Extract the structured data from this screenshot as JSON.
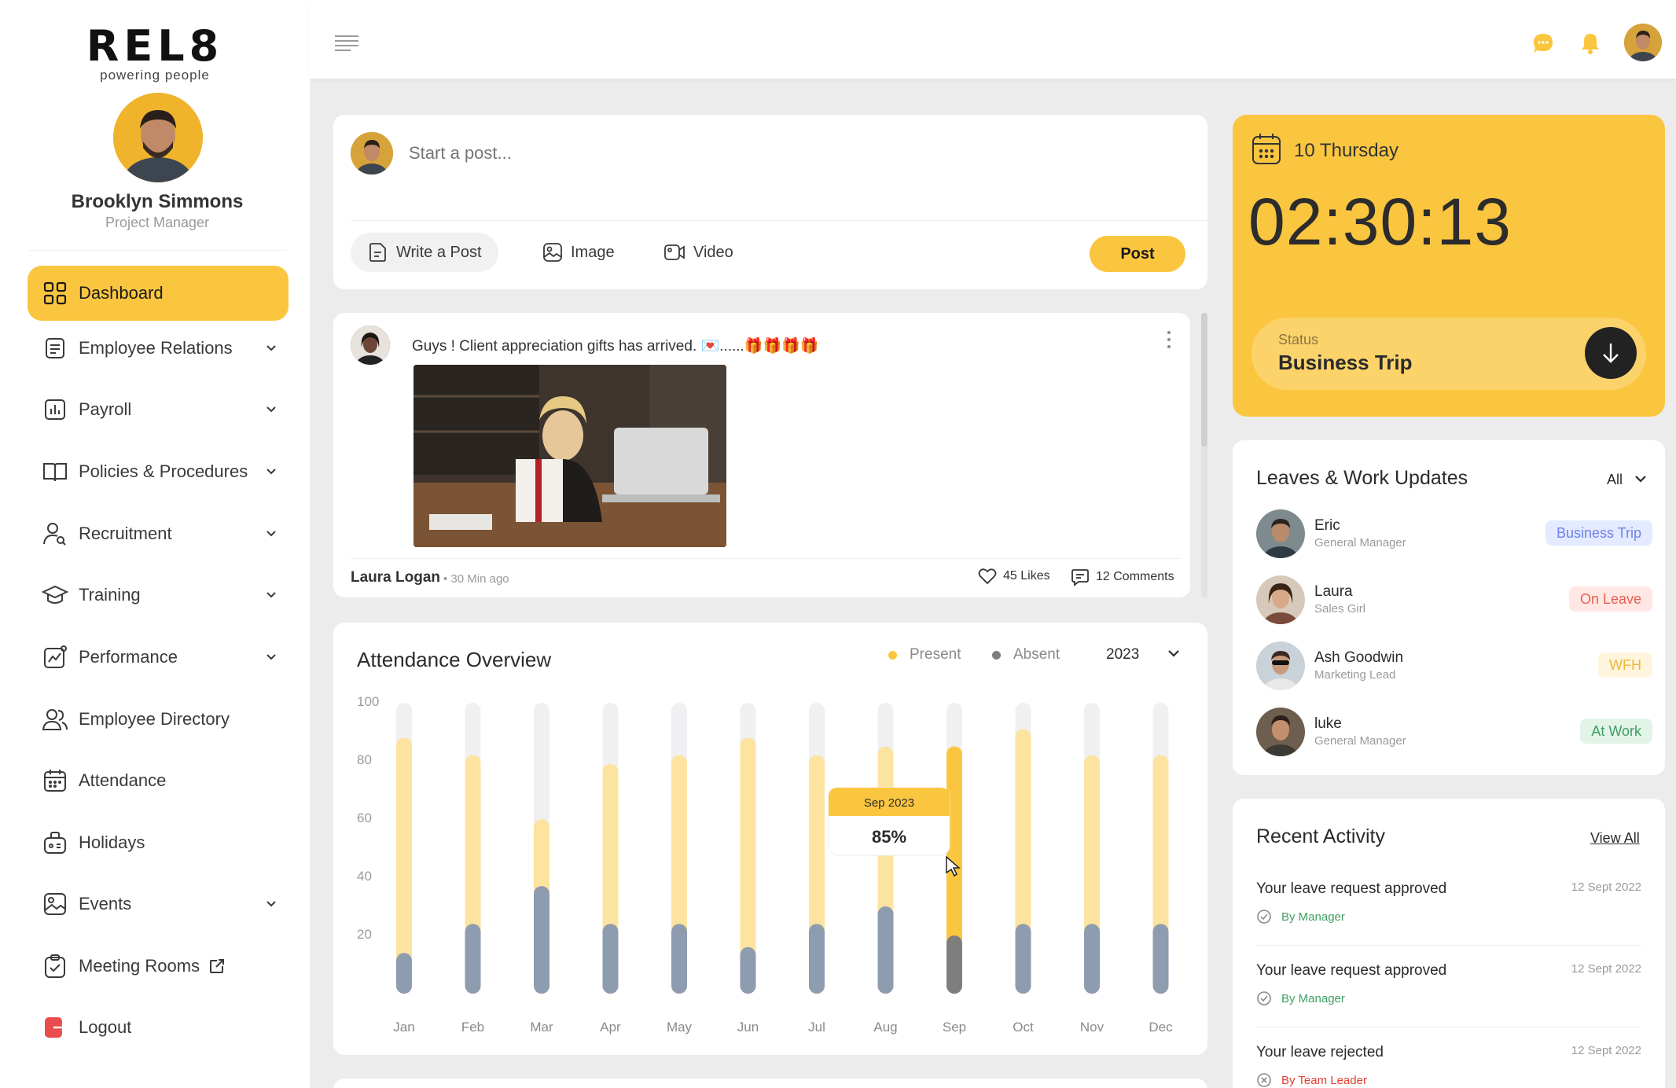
{
  "brand": {
    "name": "REL8",
    "tagline": "powering people"
  },
  "profile": {
    "name": "Brooklyn Simmons",
    "role": "Project Manager"
  },
  "nav": [
    {
      "label": "Dashboard",
      "icon": "dashboard-grid-icon",
      "active": true,
      "has_chevron": false
    },
    {
      "label": "Employee Relations",
      "icon": "document-icon",
      "has_chevron": true
    },
    {
      "label": "Payroll",
      "icon": "bar-chart-icon",
      "has_chevron": true
    },
    {
      "label": "Policies & Procedures",
      "icon": "book-icon",
      "has_chevron": true
    },
    {
      "label": "Recruitment",
      "icon": "user-search-icon",
      "has_chevron": true
    },
    {
      "label": "Training",
      "icon": "graduation-cap-icon",
      "has_chevron": true
    },
    {
      "label": "Performance",
      "icon": "trend-chart-icon",
      "has_chevron": true
    },
    {
      "label": "Employee Directory",
      "icon": "users-icon",
      "has_chevron": false
    },
    {
      "label": "Attendance",
      "icon": "calendar-icon",
      "has_chevron": false
    },
    {
      "label": "Holidays",
      "icon": "luggage-icon",
      "has_chevron": false
    },
    {
      "label": "Events",
      "icon": "image-icon",
      "has_chevron": true
    },
    {
      "label": "Meeting Rooms",
      "icon": "clipboard-check-icon",
      "has_chevron": false,
      "external": true
    },
    {
      "label": "Logout",
      "icon": "logout-icon",
      "has_chevron": false
    }
  ],
  "topbar": {
    "icons": [
      "menu-icon",
      "chat-icon",
      "bell-icon",
      "avatar"
    ]
  },
  "composer": {
    "placeholder": "Start a post...",
    "write_label": "Write a Post",
    "image_label": "Image",
    "video_label": "Video",
    "post_label": "Post"
  },
  "feed_post": {
    "text": "Guys ! Client appreciation gifts has arrived. 💌......🎁🎁🎁🎁",
    "author": "Laura Logan",
    "time": "30 Min ago",
    "likes": "45 Likes",
    "comments": "12 Comments"
  },
  "attendance": {
    "title": "Attendance Overview",
    "legend_present": "Present",
    "legend_absent": "Absent",
    "year": "2023",
    "tooltip_month": "Sep 2023",
    "tooltip_value": "85%"
  },
  "chart_data": {
    "type": "bar",
    "title": "Attendance Overview",
    "categories": [
      "Jan",
      "Feb",
      "Mar",
      "Apr",
      "May",
      "Jun",
      "Jul",
      "Aug",
      "Sep",
      "Oct",
      "Nov",
      "Dec"
    ],
    "series": [
      {
        "name": "Present",
        "values": [
          88,
          82,
          60,
          79,
          82,
          88,
          82,
          85,
          85,
          91,
          82,
          82
        ]
      },
      {
        "name": "Absent",
        "values": [
          14,
          24,
          37,
          24,
          24,
          16,
          24,
          30,
          20,
          24,
          24,
          24
        ]
      }
    ],
    "highlight": "Sep",
    "ylim": [
      0,
      100
    ],
    "yticks": [
      20,
      40,
      60,
      80,
      100
    ],
    "colors": {
      "present": "#fde3a0",
      "present_highlight": "#fbc63f",
      "absent": "#8e9cb0",
      "absent_highlight": "#7e7e7e",
      "track": "#f0f0f3"
    }
  },
  "clock": {
    "day": "10 Thursday",
    "time": "02:30:13",
    "status_label": "Status",
    "status_value": "Business Trip"
  },
  "leaves": {
    "title": "Leaves & Work Updates",
    "filter": "All",
    "rows": [
      {
        "name": "Eric",
        "role": "General Manager",
        "badge": "Business Trip",
        "badge_bg": "#e4eaff",
        "badge_color": "#6f82e8"
      },
      {
        "name": "Laura",
        "role": "Sales Girl",
        "badge": "On Leave",
        "badge_bg": "#ffe7e4",
        "badge_color": "#e8604f"
      },
      {
        "name": "Ash Goodwin",
        "role": "Marketing Lead",
        "badge": "WFH",
        "badge_bg": "#fff5dc",
        "badge_color": "#f0b63a"
      },
      {
        "name": "luke",
        "role": "General Manager",
        "badge": "At Work",
        "badge_bg": "#e2f3e8",
        "badge_color": "#3f9e62"
      }
    ]
  },
  "activity": {
    "title": "Recent Activity",
    "view_all": "View All",
    "items": [
      {
        "text": "Your leave request approved",
        "date": "12 Sept 2022",
        "by": "By Manager",
        "by_color": "#3f9e62"
      },
      {
        "text": "Your leave request approved",
        "date": "12 Sept 2022",
        "by": "By Manager",
        "by_color": "#3f9e62"
      },
      {
        "text": "Your leave rejected",
        "date": "12 Sept 2022",
        "by": "By Team Leader",
        "by_color": "#e0402f"
      }
    ]
  }
}
